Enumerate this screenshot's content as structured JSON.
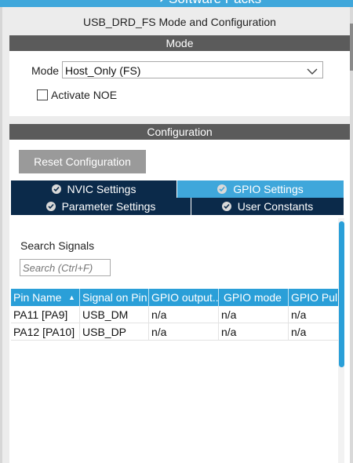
{
  "topbar": {
    "title": "Software Packs"
  },
  "header": {
    "title": "USB_DRD_FS Mode and Configuration"
  },
  "mode_section": {
    "title": "Mode",
    "mode_label": "Mode",
    "mode_value": "Host_Only (FS)",
    "activate_noe_label": "Activate NOE",
    "activate_noe_checked": false
  },
  "config_section": {
    "title": "Configuration",
    "reset_button": "Reset Configuration",
    "tabs": [
      {
        "label": "NVIC Settings",
        "active": false
      },
      {
        "label": "GPIO Settings",
        "active": true
      },
      {
        "label": "Parameter Settings",
        "active": false
      },
      {
        "label": "User Constants",
        "active": false
      }
    ],
    "search_label": "Search Signals",
    "search_placeholder": "Search (Ctrl+F)",
    "table": {
      "columns": [
        "Pin Name",
        "Signal on Pin",
        "GPIO output...",
        "GPIO mode",
        "GPIO Pull"
      ],
      "rows": [
        [
          "PA11 [PA9]",
          "USB_DM",
          "n/a",
          "n/a",
          "n/a"
        ],
        [
          "PA12 [PA10]",
          "USB_DP",
          "n/a",
          "n/a",
          "n/a"
        ]
      ]
    }
  },
  "colors": {
    "accent": "#2a9fd8",
    "section_bar": "#5b5b5b",
    "tab_dark": "#0b2a4a",
    "tab_active": "#3fa7db"
  }
}
